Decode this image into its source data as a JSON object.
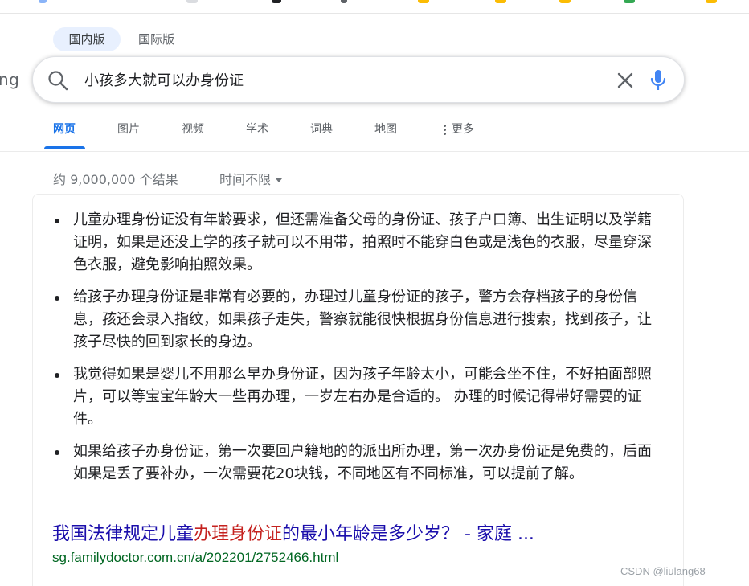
{
  "region_tabs": {
    "domestic": "国内版",
    "international": "国际版"
  },
  "logo_fragment": "ng",
  "search": {
    "query": "小孩多大就可以办身份证",
    "icons": {
      "search": "search-icon",
      "clear": "close-icon",
      "voice": "microphone-icon"
    },
    "colors": {
      "mic_accent": "#4285f4"
    }
  },
  "nav": {
    "tabs": [
      "网页",
      "图片",
      "视频",
      "学术",
      "词典",
      "地图"
    ],
    "more_label": "更多",
    "active_color": "#1a73e8"
  },
  "results": {
    "stats": "约 9,000,000 个结果",
    "time_filter": "时间不限",
    "bullets": [
      "儿童办理身份证没有年龄要求，但还需准备父母的身份证、孩子户口簿、出生证明以及学籍证明，如果是还没上学的孩子就可以不用带，拍照时不能穿白色或是浅色的衣服，尽量穿深色衣服，避免影响拍照效果。",
      "给孩子办理身份证是非常有必要的，办理过儿童身份证的孩子，警方会存档孩子的身份信息，孩还会录入指纹，如果孩子走失，警察就能很快根据身份信息进行搜索，找到孩子，让孩子尽快的回到家长的身边。",
      "我觉得如果是婴儿不用那么早办身份证，因为孩子年龄太小，可能会坐不住，不好拍面部照片，可以等宝宝年龄大一些再办理，一岁左右办是合适的。 办理的时候记得带好需要的证件。",
      "如果给孩子办身份证，第一次要回户籍地的的派出所办理，第一次办身份证是免费的，后面如果是丢了要补办，一次需要花20块钱，不同地区有不同标准，可以提前了解。"
    ],
    "title_before": "我国法律规定儿童",
    "title_highlight": "办理身份证",
    "title_after": "的最小年龄是多少岁？ - 家庭 ...",
    "url": "sg.familydoctor.com.cn/a/202201/2752466.html",
    "colors": {
      "title": "#1a0dab",
      "highlight": "#c5221f",
      "url": "#006621"
    }
  },
  "watermark": "CSDN @liulang68"
}
